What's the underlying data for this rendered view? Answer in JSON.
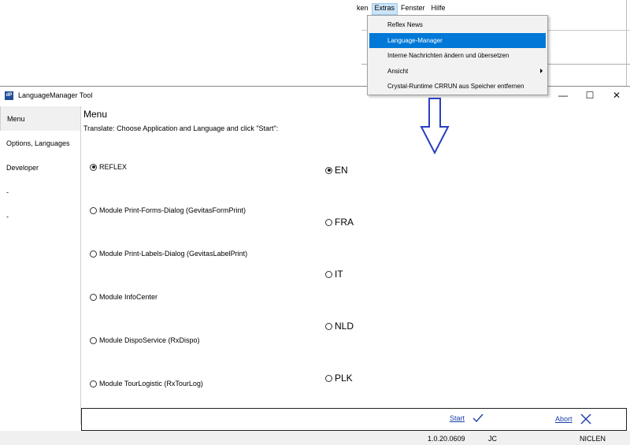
{
  "background_menu": {
    "items": [
      {
        "label": "ken",
        "active": false
      },
      {
        "label": "Extras",
        "active": true
      },
      {
        "label": "Fenster",
        "active": false
      },
      {
        "label": "Hilfe",
        "active": false
      }
    ]
  },
  "dropdown": {
    "items": [
      {
        "label": "Reflex News",
        "highlighted": false,
        "submenu": false
      },
      {
        "label": "Language-Manager",
        "highlighted": true,
        "submenu": false
      },
      {
        "label": "Interne Nachrichten ändern und übersetzen",
        "highlighted": false,
        "submenu": false
      },
      {
        "label": "Ansicht",
        "highlighted": false,
        "submenu": true
      },
      {
        "label": "Crystal-Runtime CRRUN aus Speicher entfernen",
        "highlighted": false,
        "submenu": false
      }
    ]
  },
  "window": {
    "icon_text": "dP",
    "title": "LanguageManager Tool",
    "controls": {
      "minimize": "—",
      "maximize": "☐",
      "close": "✕"
    }
  },
  "sidebar": {
    "items": [
      {
        "label": "Menu",
        "selected": true
      },
      {
        "label": "Options, Languages",
        "selected": false
      },
      {
        "label": "Developer",
        "selected": false
      },
      {
        "label": "-",
        "selected": false
      },
      {
        "label": "-",
        "selected": false
      }
    ]
  },
  "main": {
    "title": "Menu",
    "instructions": "Translate: Choose Application and Language and click \"Start\":",
    "applications": [
      {
        "label": "REFLEX",
        "checked": true
      },
      {
        "label": "Module Print-Forms-Dialog (GevitasFormPrint)",
        "checked": false
      },
      {
        "label": "Module Print-Labels-Dialog (GevitasLabelPrint)",
        "checked": false
      },
      {
        "label": "Module InfoCenter",
        "checked": false
      },
      {
        "label": "Module DispoService (RxDispo)",
        "checked": false
      },
      {
        "label": "Module TourLogistic (RxTourLog)",
        "checked": false
      }
    ],
    "languages": [
      {
        "label": "EN",
        "checked": true
      },
      {
        "label": "FRA",
        "checked": false
      },
      {
        "label": "IT",
        "checked": false
      },
      {
        "label": "NLD",
        "checked": false
      },
      {
        "label": "PLK",
        "checked": false
      }
    ]
  },
  "actions": {
    "start_label": "Start",
    "abort_label": "Abort",
    "start_icon": "checkmark-icon",
    "abort_icon": "x-icon"
  },
  "status": {
    "version": "1.0.20.0609",
    "user_initials": "JC",
    "machine": "NICLEN"
  },
  "colors": {
    "highlight": "#0078d7",
    "link": "#1a3fa8",
    "arrow": "#2a3fbf"
  }
}
